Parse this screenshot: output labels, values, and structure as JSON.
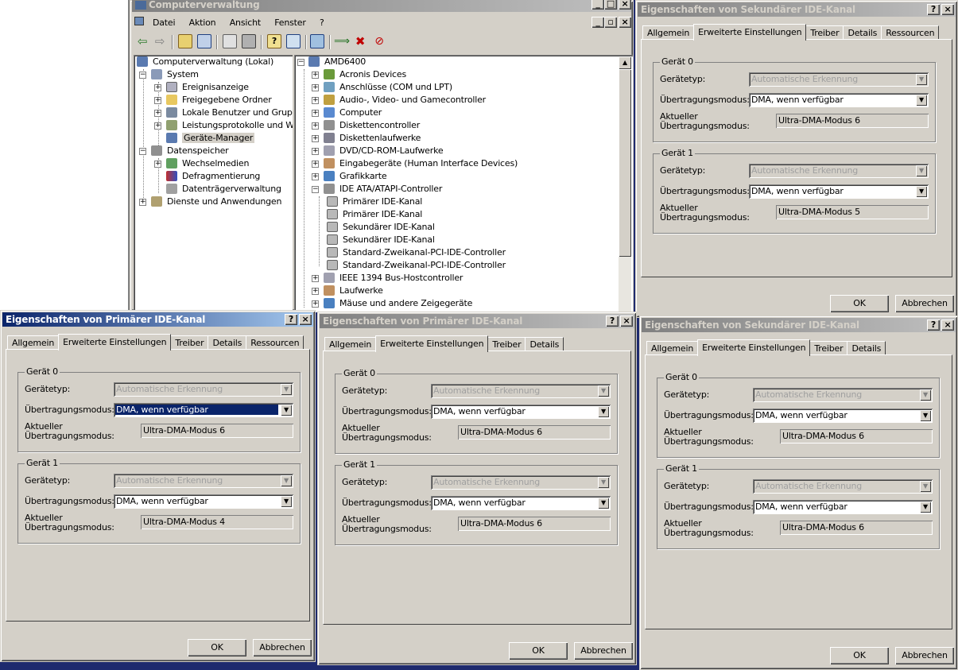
{
  "main": {
    "title": "Computerverwaltung",
    "menu": [
      "Datei",
      "Aktion",
      "Ansicht",
      "Fenster",
      "?"
    ],
    "left_tree": {
      "root": "Computerverwaltung (Lokal)",
      "items": [
        "System",
        "Ereignisanzeige",
        "Freigegebene Ordner",
        "Lokale Benutzer und Gruppen",
        "Leistungsprotokolle und Warnungen",
        "Geräte-Manager",
        "Datenspeicher",
        "Wechselmedien",
        "Defragmentierung",
        "Datenträgerverwaltung",
        "Dienste und Anwendungen"
      ]
    },
    "device_tree": {
      "root": "AMD6400",
      "items": [
        "Acronis Devices",
        "Anschlüsse (COM und LPT)",
        "Audio-, Video- und Gamecontroller",
        "Computer",
        "Diskettencontroller",
        "Diskettenlaufwerke",
        "DVD/CD-ROM-Laufwerke",
        "Eingabegeräte (Human Interface Devices)",
        "Grafikkarte",
        "IDE ATA/ATAPI-Controller",
        "Primärer IDE-Kanal",
        "Primärer IDE-Kanal",
        "Sekundärer IDE-Kanal",
        "Sekundärer IDE-Kanal",
        "Standard-Zweikanal-PCI-IDE-Controller",
        "Standard-Zweikanal-PCI-IDE-Controller",
        "IEEE 1394 Bus-Hostcontroller",
        "Laufwerke",
        "Mäuse und andere Zeigegeräte"
      ]
    }
  },
  "labels": {
    "group0": "Gerät 0",
    "group1": "Gerät 1",
    "device_type": "Gerätetyp:",
    "transfer_mode": "Übertragungsmodus:",
    "current_line1": "Aktueller",
    "current_line2": "Übertragungsmodus:",
    "auto_detect": "Automatische Erkennung",
    "dma": "DMA, wenn verfügbar",
    "ok": "OK",
    "cancel": "Abbrechen",
    "help": "?",
    "close": "×"
  },
  "dialogs": [
    {
      "title": "Eigenschaften von Sekundärer IDE-Kanal",
      "tabs": [
        "Allgemein",
        "Erweiterte Einstellungen",
        "Treiber",
        "Details",
        "Ressourcen"
      ],
      "selected_tab": "Erweiterte Einstellungen",
      "device0_current": "Ultra-DMA-Modus 6",
      "device1_current": "Ultra-DMA-Modus 5"
    },
    {
      "title": "Eigenschaften von Primärer IDE-Kanal",
      "tabs": [
        "Allgemein",
        "Erweiterte Einstellungen",
        "Treiber",
        "Details",
        "Ressourcen"
      ],
      "selected_tab": "Erweiterte Einstellungen",
      "device0_current": "Ultra-DMA-Modus 6",
      "device1_current": "Ultra-DMA-Modus 4"
    },
    {
      "title": "Eigenschaften von Primärer IDE-Kanal",
      "tabs": [
        "Allgemein",
        "Erweiterte Einstellungen",
        "Treiber",
        "Details"
      ],
      "selected_tab": "Erweiterte Einstellungen",
      "device0_current": "Ultra-DMA-Modus 6",
      "device1_current": "Ultra-DMA-Modus 6"
    },
    {
      "title": "Eigenschaften von Sekundärer IDE-Kanal",
      "tabs": [
        "Allgemein",
        "Erweiterte Einstellungen",
        "Treiber",
        "Details"
      ],
      "selected_tab": "Erweiterte Einstellungen",
      "device0_current": "Ultra-DMA-Modus 6",
      "device1_current": "Ultra-DMA-Modus 6"
    }
  ]
}
